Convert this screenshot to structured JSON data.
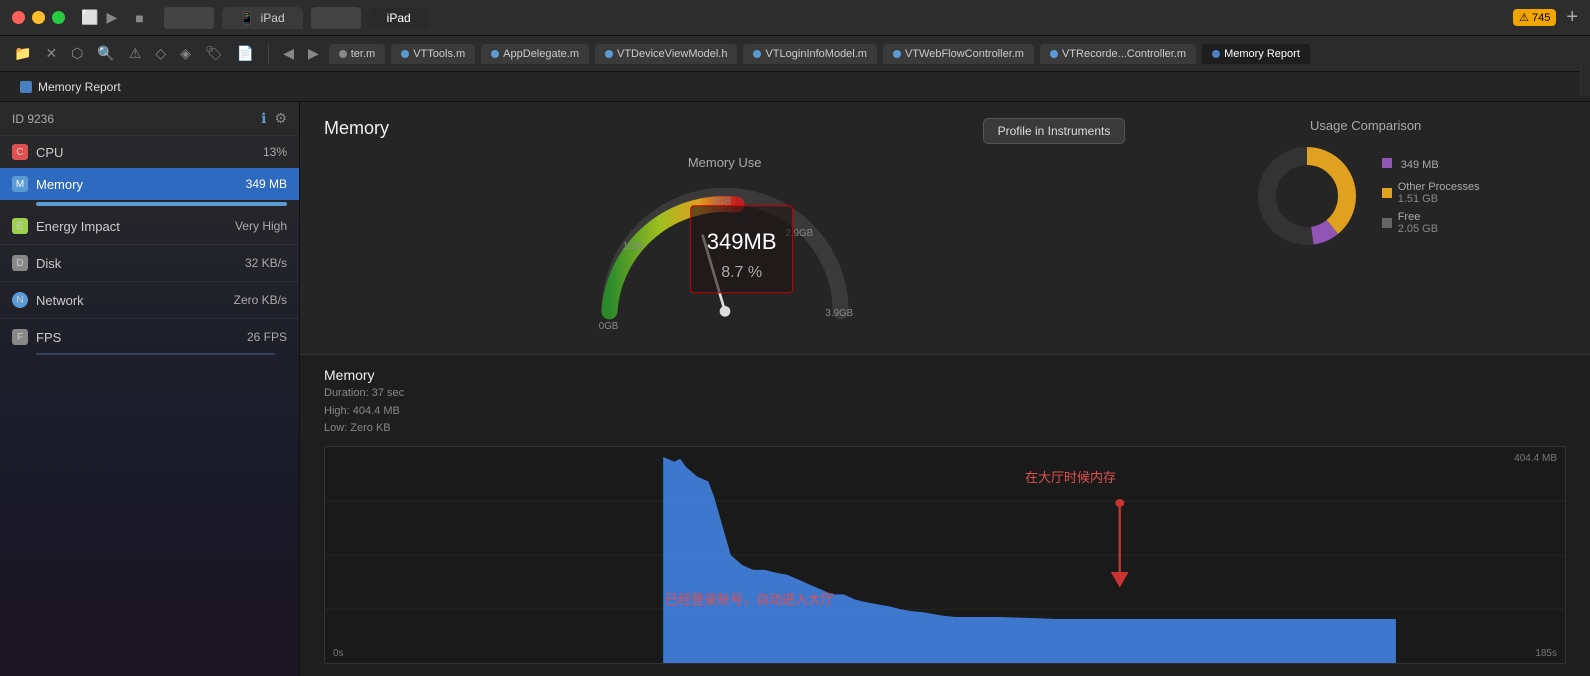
{
  "titlebar": {
    "device_tab_1": "iPad",
    "device_tab_2": "iPad",
    "warning_count": "745",
    "add_label": "+"
  },
  "toolbar": {
    "tabs": [
      {
        "label": "ter.m",
        "icon_color": "gray"
      },
      {
        "label": "VTTools.m",
        "icon_color": "blue"
      },
      {
        "label": "AppDelegate.m",
        "icon_color": "blue"
      },
      {
        "label": "VTDeviceViewModel.h",
        "icon_color": "blue"
      },
      {
        "label": "VTLoginInfoModel.m",
        "icon_color": "blue"
      },
      {
        "label": "VTWebFlowController.m",
        "icon_color": "blue"
      },
      {
        "label": "VTRecorde...Controller.m",
        "icon_color": "blue"
      },
      {
        "label": "Memory Report",
        "icon_color": "memory",
        "active": true
      }
    ]
  },
  "toolbar2": {
    "tab_label": "Memory Report"
  },
  "sidebar": {
    "id_label": "ID 9236",
    "items": [
      {
        "label": "CPU",
        "value": "13%",
        "icon_type": "cpu"
      },
      {
        "label": "Memory",
        "value": "349 MB",
        "icon_type": "memory",
        "active": true
      },
      {
        "label": "Energy Impact",
        "value": "Very High",
        "icon_type": "energy"
      },
      {
        "label": "Disk",
        "value": "32 KB/s",
        "icon_type": "disk"
      },
      {
        "label": "Network",
        "value": "Zero KB/s",
        "icon_type": "network"
      },
      {
        "label": "FPS",
        "value": "26 FPS",
        "icon_type": "fps"
      }
    ]
  },
  "memory_header": {
    "title": "Memory",
    "profile_btn": "Profile in Instruments",
    "gauge": {
      "title": "Memory Use",
      "value_mb": "349",
      "unit_mb": "MB",
      "value_pct": "8.7",
      "unit_pct": "%",
      "labels": {
        "0gb": "0GB",
        "1gb": "1GB",
        "2gb": "2GB",
        "2_9gb": "2.9GB",
        "3_9gb": "3.9GB"
      }
    },
    "usage_comparison": {
      "title": "Usage Comparison",
      "this_app_label": "349 MB",
      "items": [
        {
          "label": "Other Processes",
          "value": "1.51 GB",
          "color": "#e0a020"
        },
        {
          "label": "Free",
          "value": "2.05 GB",
          "color": "#666"
        }
      ]
    }
  },
  "memory_graph": {
    "title": "Memory",
    "y_label": "404.4 MB",
    "x_start": "0s",
    "x_end": "185s",
    "duration": "Duration: 37 sec",
    "high": "High: 404.4 MB",
    "low": "Low: Zero KB",
    "annotation1": "在大厅时候内存",
    "annotation2": "已经登录账号，自动进入大厅"
  }
}
